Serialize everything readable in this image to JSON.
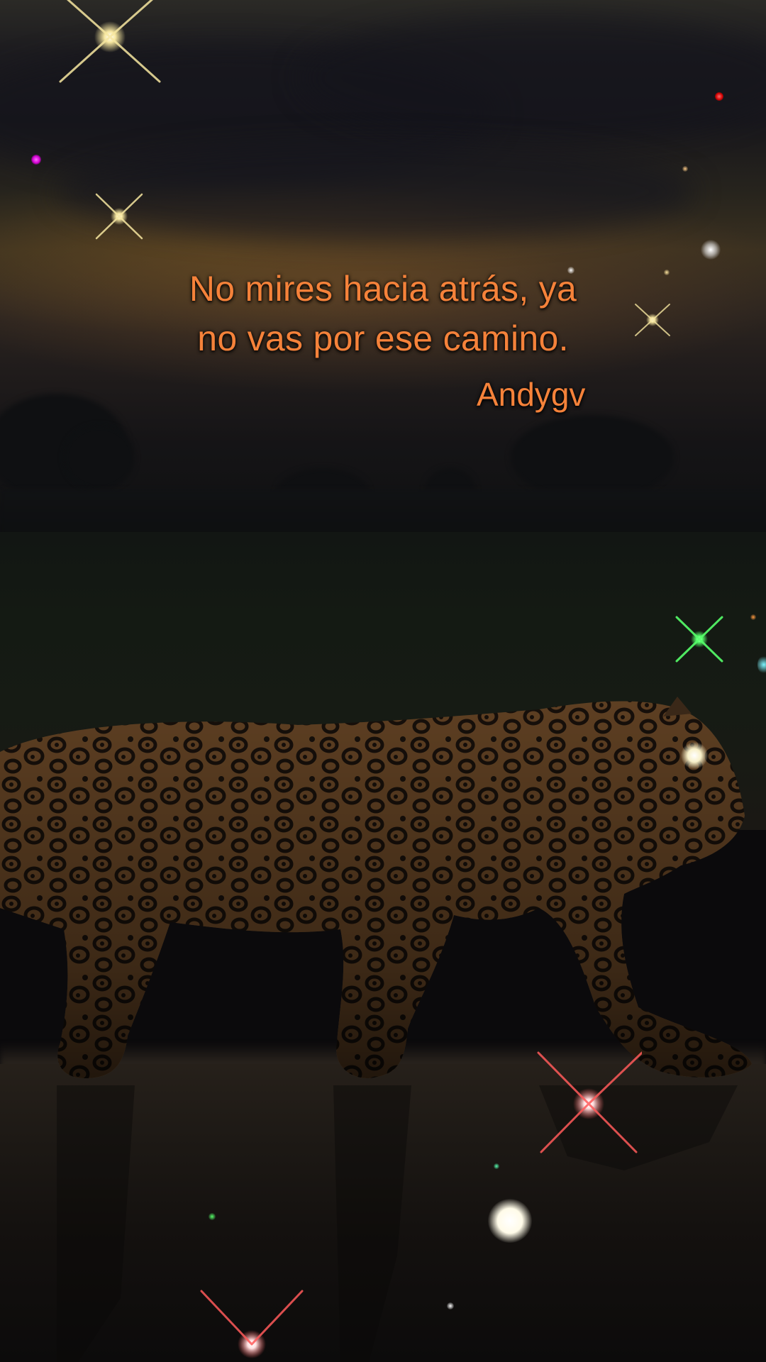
{
  "quote": {
    "line1": "No mires hacia atrás, ya",
    "line2": "no vas por ese camino.",
    "author": "Andygv",
    "color": "#f5823a"
  },
  "scene": {
    "subject": "jaguar-icon",
    "sparkle_colors": {
      "gold": "#f7e7a0",
      "red": "#ff5a5a",
      "green": "#56ff6a",
      "white": "#ffffff"
    }
  }
}
